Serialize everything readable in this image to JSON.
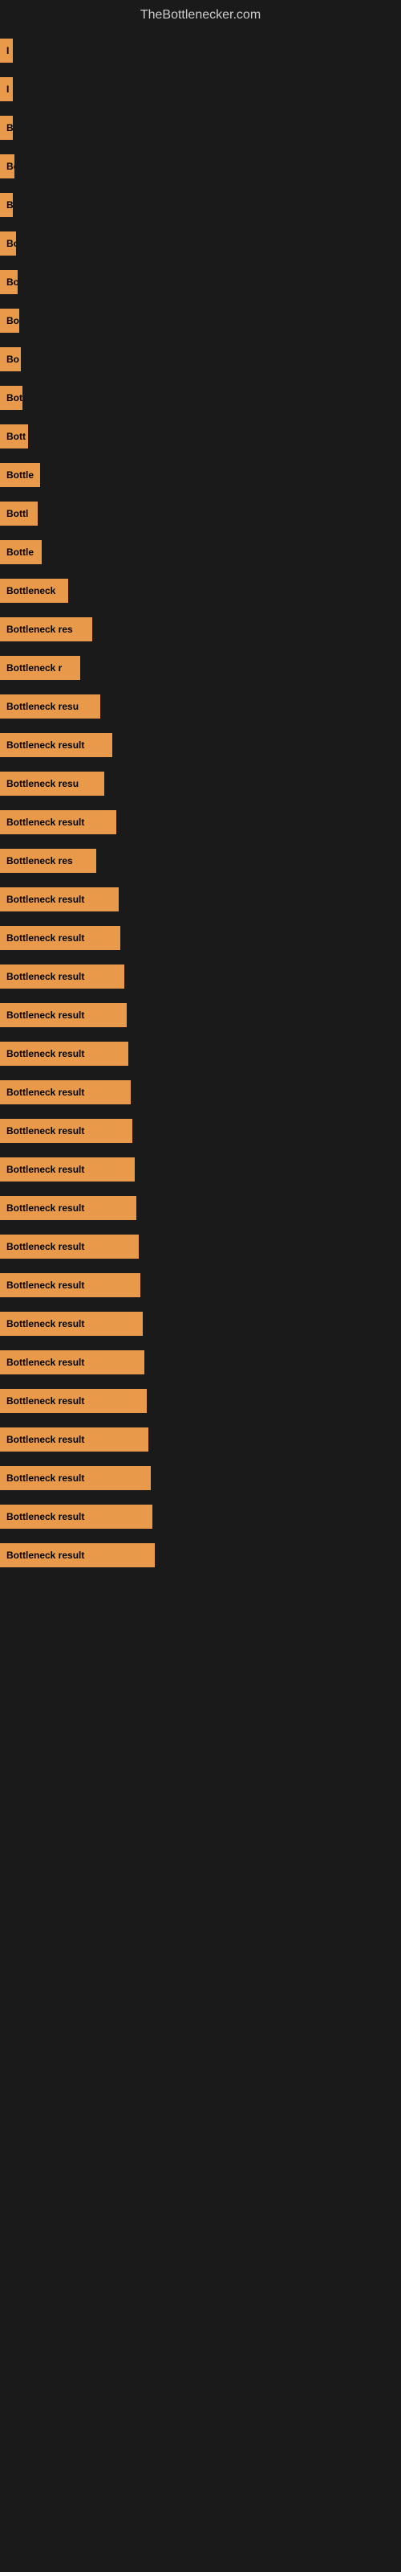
{
  "site": {
    "title": "TheBottlenecker.com"
  },
  "bars": [
    {
      "label": "I",
      "width": 10
    },
    {
      "label": "I",
      "width": 10
    },
    {
      "label": "B",
      "width": 14
    },
    {
      "label": "Bo",
      "width": 18
    },
    {
      "label": "B",
      "width": 14
    },
    {
      "label": "Bo",
      "width": 20
    },
    {
      "label": "Bo",
      "width": 22
    },
    {
      "label": "Bo",
      "width": 24
    },
    {
      "label": "Bo",
      "width": 26
    },
    {
      "label": "Bot",
      "width": 28
    },
    {
      "label": "Bott",
      "width": 35
    },
    {
      "label": "Bottle",
      "width": 50
    },
    {
      "label": "Bottl",
      "width": 47
    },
    {
      "label": "Bottle",
      "width": 52
    },
    {
      "label": "Bottleneck",
      "width": 85
    },
    {
      "label": "Bottleneck res",
      "width": 115
    },
    {
      "label": "Bottleneck r",
      "width": 100
    },
    {
      "label": "Bottleneck resu",
      "width": 125
    },
    {
      "label": "Bottleneck result",
      "width": 140
    },
    {
      "label": "Bottleneck resu",
      "width": 130
    },
    {
      "label": "Bottleneck result",
      "width": 145
    },
    {
      "label": "Bottleneck res",
      "width": 120
    },
    {
      "label": "Bottleneck result",
      "width": 148
    },
    {
      "label": "Bottleneck result",
      "width": 150
    },
    {
      "label": "Bottleneck result",
      "width": 155
    },
    {
      "label": "Bottleneck result",
      "width": 158
    },
    {
      "label": "Bottleneck result",
      "width": 160
    },
    {
      "label": "Bottleneck result",
      "width": 163
    },
    {
      "label": "Bottleneck result",
      "width": 165
    },
    {
      "label": "Bottleneck result",
      "width": 168
    },
    {
      "label": "Bottleneck result",
      "width": 170
    },
    {
      "label": "Bottleneck result",
      "width": 173
    },
    {
      "label": "Bottleneck result",
      "width": 175
    },
    {
      "label": "Bottleneck result",
      "width": 178
    },
    {
      "label": "Bottleneck result",
      "width": 180
    },
    {
      "label": "Bottleneck result",
      "width": 183
    },
    {
      "label": "Bottleneck result",
      "width": 185
    },
    {
      "label": "Bottleneck result",
      "width": 188
    },
    {
      "label": "Bottleneck result",
      "width": 190
    },
    {
      "label": "Bottleneck result",
      "width": 193
    }
  ]
}
